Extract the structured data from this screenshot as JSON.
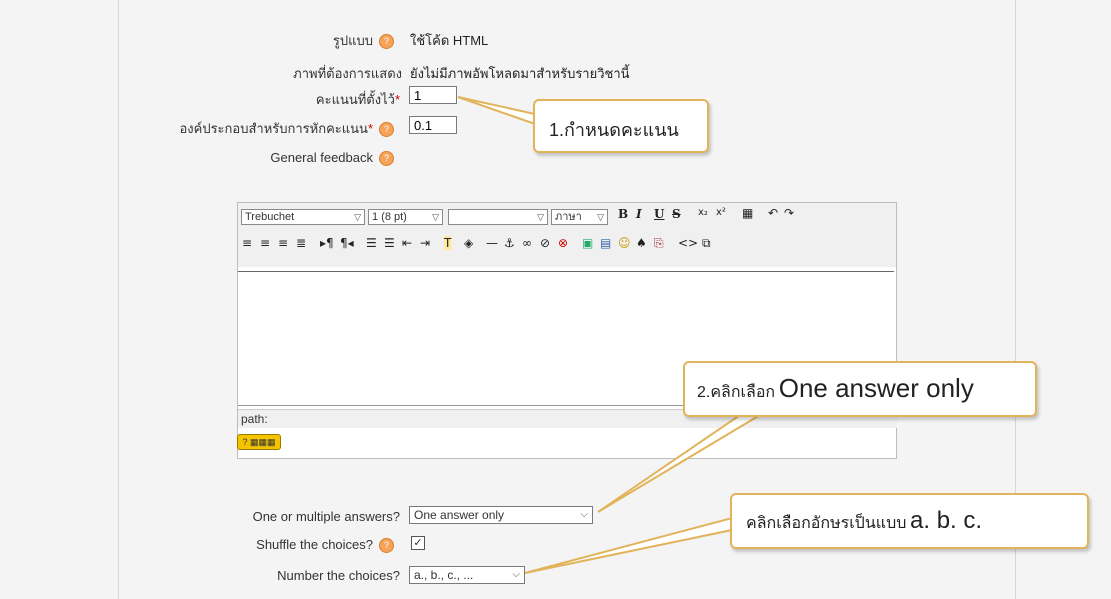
{
  "form": {
    "format_label": "รูปแบบ",
    "format_value": "ใช้โค้ด HTML",
    "image_label": "ภาพที่ต้องการแสดง",
    "image_value": "ยังไม่มีภาพอัพโหลดมาสำหรับรายวิชานี้",
    "default_grade_label": "คะแนนที่ตั้งไว้",
    "default_grade_value": "1",
    "penalty_label": "องค์ประกอบสำหรับการหักคะแนน",
    "penalty_value": "0.1",
    "general_feedback_label": "General feedback",
    "required_mark": "*",
    "multi_answer_label": "One or multiple answers?",
    "multi_answer_value": "One answer only",
    "shuffle_label": "Shuffle the choices?",
    "shuffle_checked": true,
    "numbering_label": "Number the choices?",
    "numbering_value": "a., b., c., ..."
  },
  "editor": {
    "font_family": "Trebuchet",
    "font_size": "1 (8 pt)",
    "heading": "",
    "language": "ภาษา",
    "path_label": "path:",
    "keyboard_button": "?"
  },
  "callouts": {
    "grade": "1.กำหนดคะแนน",
    "answer_prefix": "2.คลิกเลือก",
    "answer_big": "One answer only",
    "numbering_prefix": "คลิกเลือกอักษรเป็นแบบ",
    "numbering_big": "a. b. c."
  },
  "colors": {
    "callout_border": "#e1b35a",
    "help_icon": "#f6a35a",
    "required": "#cc0000"
  }
}
